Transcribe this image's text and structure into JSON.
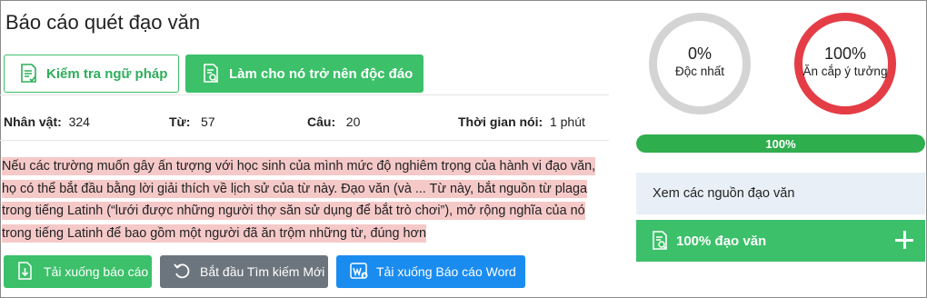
{
  "header": {
    "title": "Báo cáo quét đạo văn"
  },
  "actions": {
    "grammar_label": "Kiểm tra ngữ pháp",
    "unique_label": "Làm cho nó trở nên độc đáo"
  },
  "stats": {
    "characters_label": "Nhân vật:",
    "characters_value": "324",
    "words_label": "Từ:",
    "words_value": "57",
    "sentences_label": "Câu:",
    "sentences_value": "20",
    "speak_time_label": "Thời gian nói:",
    "speak_time_value": "1 phút"
  },
  "passage": {
    "text": " Nếu các trường muốn gây ấn tượng với học sinh của mình mức độ nghiêm trọng của hành vi đạo văn, họ có thể bắt đầu bằng lời giải thích về lịch sử của từ này. Đạo văn (và ... Từ này, bắt nguồn từ plaga trong tiếng Latinh (“lưới được những người thợ săn sử dụng để bắt trò chơi”), mở rộng nghĩa của nó trong tiếng Latinh để bao gồm một người đã ăn trộm  những từ, đúng hơn"
  },
  "bottom_buttons": {
    "download_label": "Tải xuống báo cáo",
    "restart_label": "Bắt đầu Tìm kiếm Mới",
    "word_label": "Tải xuống Báo cáo Word"
  },
  "gauges": {
    "unique_pct": "0%",
    "unique_label": "Độc nhất",
    "plag_pct": "100%",
    "plag_label": "Ăn cắp ý tưởng"
  },
  "progress": {
    "label": "100%",
    "value": 1.0
  },
  "sources": {
    "label": "Xem các nguồn đạo văn"
  },
  "plag_card": {
    "label": "100% đạo văn"
  },
  "colors": {
    "green": "#3cc06a",
    "progress_green": "#2eae4d",
    "gray": "#6c757d",
    "blue": "#1a8cf0",
    "red": "#e43d46",
    "highlight": "#f6c9c9"
  }
}
